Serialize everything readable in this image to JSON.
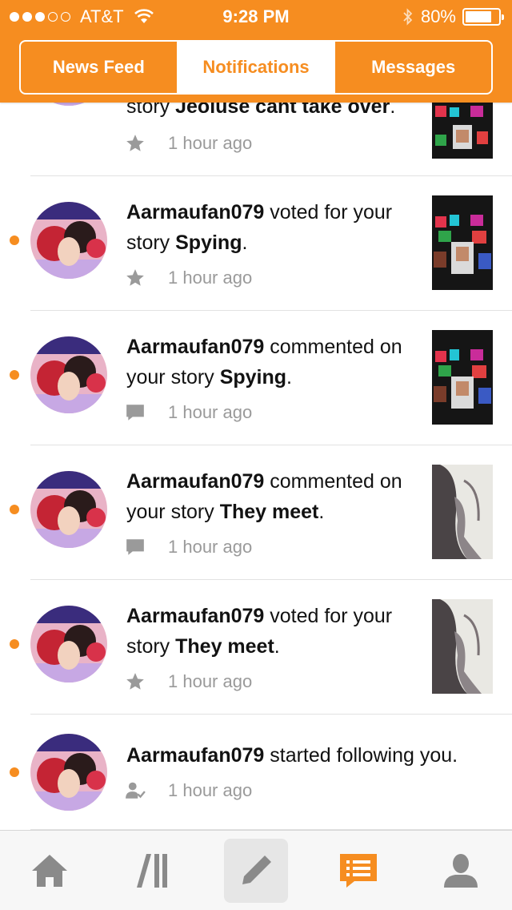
{
  "status_bar": {
    "carrier": "AT&T",
    "time": "9:28 PM",
    "battery": "80%",
    "battery_level": 0.8,
    "signal_bars": 3
  },
  "tabs": [
    {
      "label": "News Feed",
      "active": false
    },
    {
      "label": "Notifications",
      "active": true
    },
    {
      "label": "Messages",
      "active": false
    }
  ],
  "notifications": [
    {
      "user": "",
      "action": "story ",
      "story": "Jeoluse cant take over",
      "suffix": ".",
      "time": "1 hour ago",
      "icon": "star-icon",
      "unread": false
    },
    {
      "user": "Aarmaufan079",
      "action": " voted for your story ",
      "story": "Spying",
      "suffix": ".",
      "time": "1 hour ago",
      "icon": "star-icon",
      "unread": true
    },
    {
      "user": "Aarmaufan079",
      "action": " commented on your story ",
      "story": "Spying",
      "suffix": ".",
      "time": "1 hour ago",
      "icon": "comment-icon",
      "unread": true
    },
    {
      "user": "Aarmaufan079",
      "action": " commented on your story ",
      "story": "They meet",
      "suffix": ".",
      "time": "1 hour ago",
      "icon": "comment-icon",
      "unread": true
    },
    {
      "user": "Aarmaufan079",
      "action": " voted for your story ",
      "story": "They meet",
      "suffix": ".",
      "time": "1 hour ago",
      "icon": "star-icon",
      "unread": true
    },
    {
      "user": "Aarmaufan079",
      "action": " started following you.",
      "story": "",
      "suffix": "",
      "time": "1 hour ago",
      "icon": "follow-icon",
      "unread": true
    }
  ],
  "bottom_nav": [
    {
      "name": "home",
      "icon": "home-icon"
    },
    {
      "name": "library",
      "icon": "library-icon"
    },
    {
      "name": "write",
      "icon": "pencil-icon"
    },
    {
      "name": "notifications",
      "icon": "notifications-icon"
    },
    {
      "name": "profile",
      "icon": "profile-icon"
    }
  ],
  "colors": {
    "brand": "#f68d20",
    "meta_text": "#9a9a9a",
    "divider": "#e2e2e2"
  }
}
